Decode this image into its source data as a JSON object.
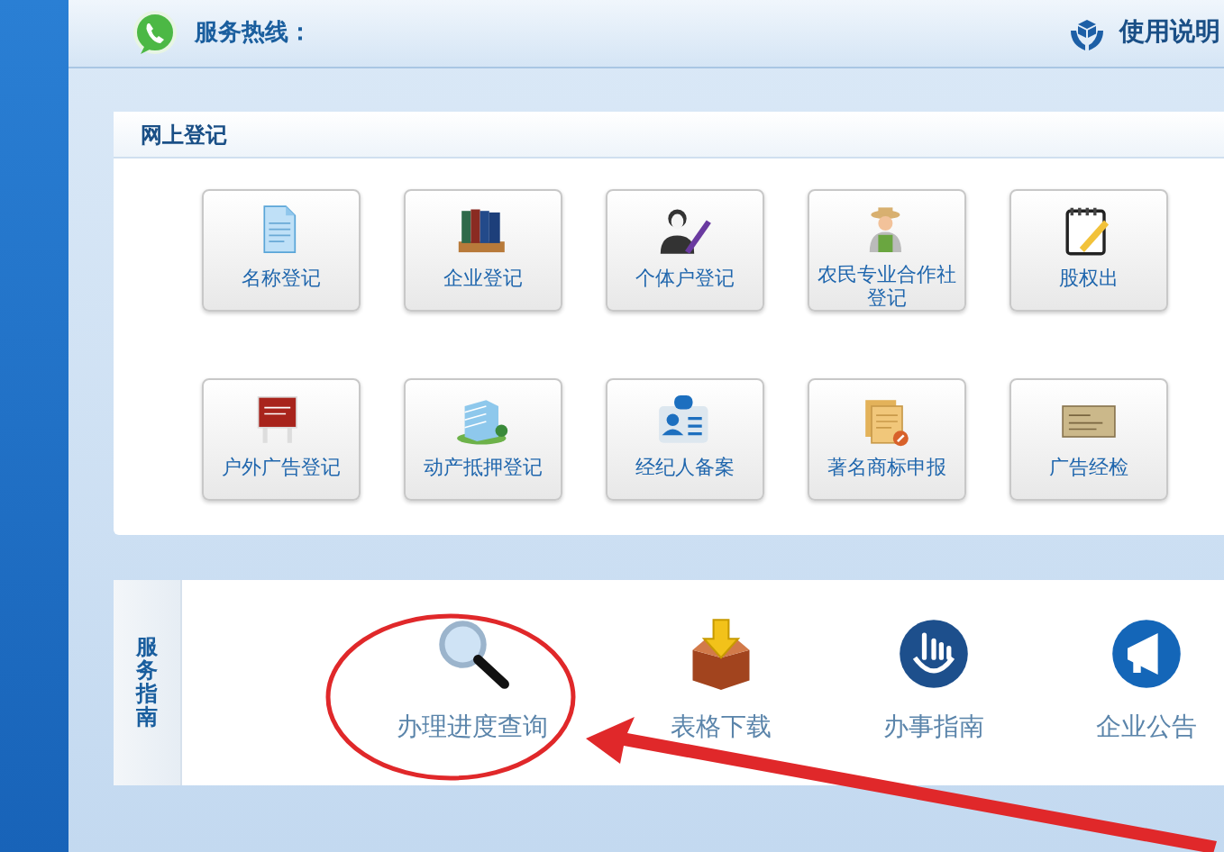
{
  "header": {
    "hotline_label": "服务热线：",
    "help_link": "使用说明"
  },
  "online_registration": {
    "title": "网上登记",
    "tiles": [
      {
        "label": "名称登记"
      },
      {
        "label": "企业登记"
      },
      {
        "label": "个体户登记"
      },
      {
        "label": "农民专业合作社登记"
      },
      {
        "label": "股权出"
      },
      {
        "label": "户外广告登记"
      },
      {
        "label": "动产抵押登记"
      },
      {
        "label": "经纪人备案"
      },
      {
        "label": "著名商标申报"
      },
      {
        "label": "广告经检"
      }
    ]
  },
  "service_guide": {
    "title": "服务指南",
    "items": [
      {
        "label": "办理进度查询",
        "circled": true
      },
      {
        "label": "表格下载",
        "circled": false
      },
      {
        "label": "办事指南",
        "circled": false
      },
      {
        "label": "企业公告",
        "circled": false
      }
    ]
  }
}
